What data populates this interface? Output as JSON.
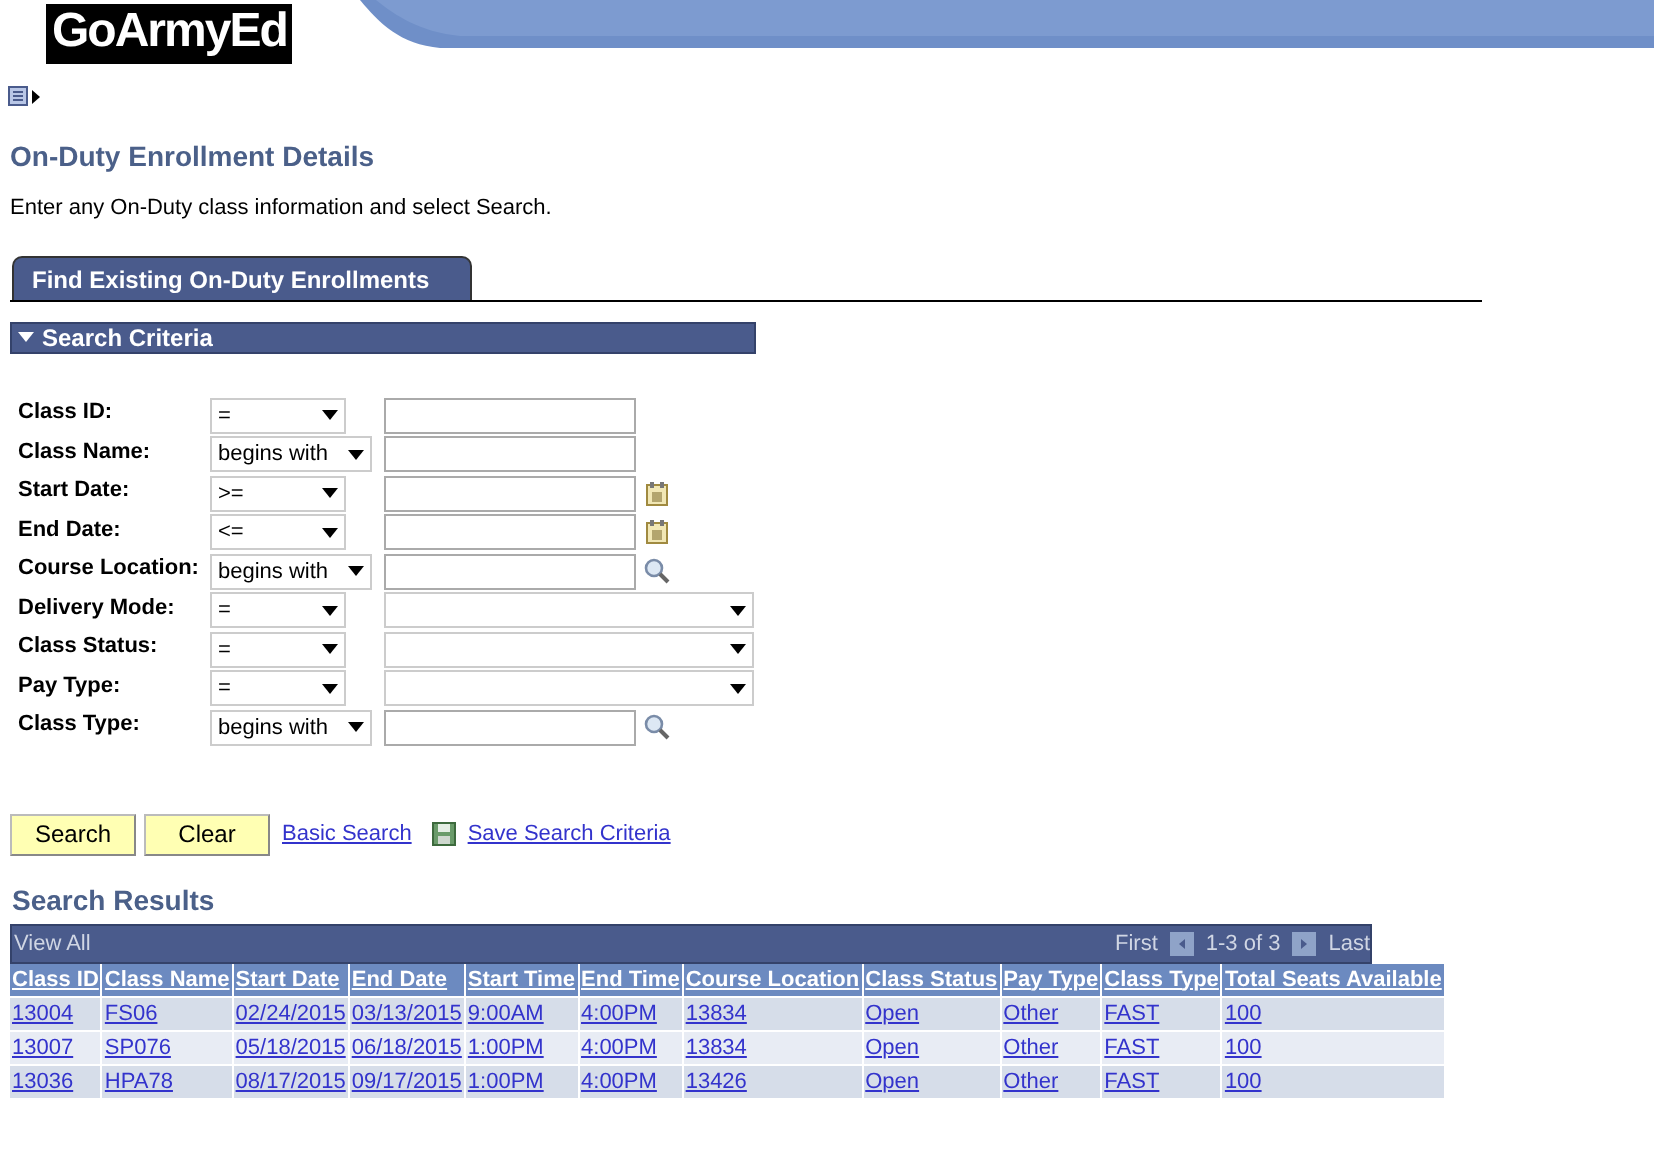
{
  "header": {
    "logo": "GoArmyEd"
  },
  "page": {
    "title": "On-Duty Enrollment Details",
    "instructions": "Enter any On-Duty class information and select Search."
  },
  "tabs": [
    {
      "label": "Find Existing On-Duty Enrollments",
      "selected": true
    }
  ],
  "section": {
    "title": "Search Criteria",
    "expanded": true
  },
  "fields": [
    {
      "label": "Class ID:",
      "operator": "=",
      "kind": "text"
    },
    {
      "label": "Class Name:",
      "operator": "begins with",
      "kind": "text"
    },
    {
      "label": "Start Date:",
      "operator": ">=",
      "kind": "date"
    },
    {
      "label": "End Date:",
      "operator": "<=",
      "kind": "date"
    },
    {
      "label": "Course Location:",
      "operator": "begins with",
      "kind": "lookup"
    },
    {
      "label": "Delivery Mode:",
      "operator": "=",
      "kind": "select"
    },
    {
      "label": "Class Status:",
      "operator": "=",
      "kind": "select"
    },
    {
      "label": "Pay Type:",
      "operator": "=",
      "kind": "select"
    },
    {
      "label": "Class Type:",
      "operator": "begins with",
      "kind": "lookup"
    }
  ],
  "actions": {
    "buttons": [
      "Search",
      "Clear"
    ],
    "links": [
      "Basic Search",
      "Save Search Criteria"
    ]
  },
  "results": {
    "title": "Search Results",
    "view_all": "View All",
    "first": "First",
    "range": "1-3 of 3",
    "last": "Last",
    "columns": [
      "Class ID",
      "Class Name",
      "Start Date",
      "End Date",
      "Start Time",
      "End Time",
      "Course Location",
      "Class Status",
      "Pay Type",
      "Class Type",
      "Total Seats Available"
    ],
    "rows": [
      [
        "13004",
        "FS06",
        "02/24/2015",
        "03/13/2015",
        "9:00AM",
        "4:00PM",
        "13834",
        "Open",
        "Other",
        "FAST",
        "100"
      ],
      [
        "13007",
        "SP076",
        "05/18/2015",
        "06/18/2015",
        "1:00PM",
        "4:00PM",
        "13834",
        "Open",
        "Other",
        "FAST",
        "100"
      ],
      [
        "13036",
        "HPA78",
        "08/17/2015",
        "09/17/2015",
        "1:00PM",
        "4:00PM",
        "13426",
        "Open",
        "Other",
        "FAST",
        "100"
      ]
    ]
  }
}
